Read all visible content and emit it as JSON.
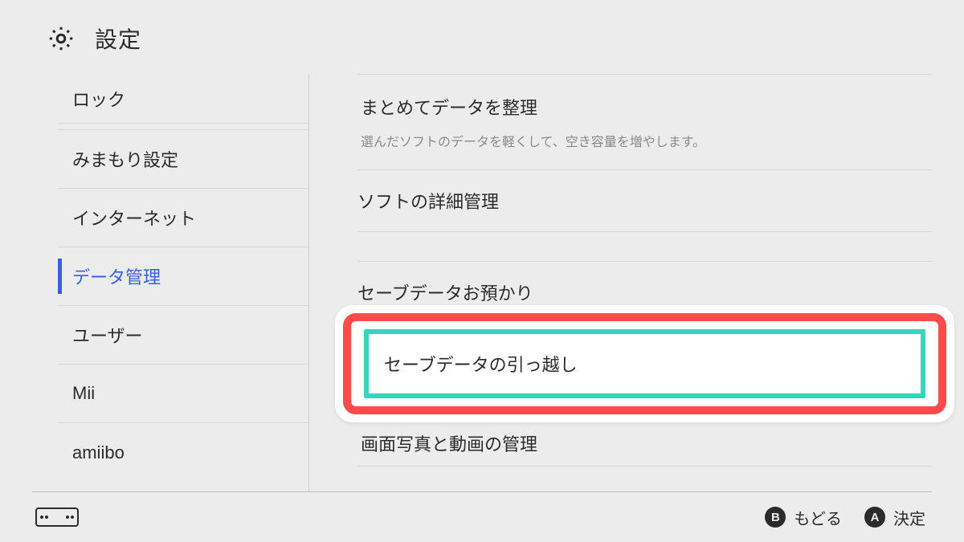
{
  "header": {
    "title": "設定"
  },
  "sidebar": {
    "items": [
      {
        "label": "ロック"
      },
      {
        "label": "みまもり設定"
      },
      {
        "label": "インターネット"
      },
      {
        "label": "データ管理",
        "active": true
      },
      {
        "label": "ユーザー"
      },
      {
        "label": "Mii"
      },
      {
        "label": "amiibo"
      }
    ]
  },
  "content": {
    "organize": {
      "title": "まとめてデータを整理",
      "desc": "選んだソフトのデータを軽くして、空き容量を増やします。"
    },
    "detail": {
      "title": "ソフトの詳細管理"
    },
    "cloud_partial": {
      "title": "セーブデータお預かり"
    },
    "transfer": {
      "title": "セーブデータの引っ越し"
    },
    "screenshots": {
      "title": "画面写真と動画の管理"
    }
  },
  "footer": {
    "back_key": "B",
    "back_label": "もどる",
    "ok_key": "A",
    "ok_label": "決定"
  }
}
